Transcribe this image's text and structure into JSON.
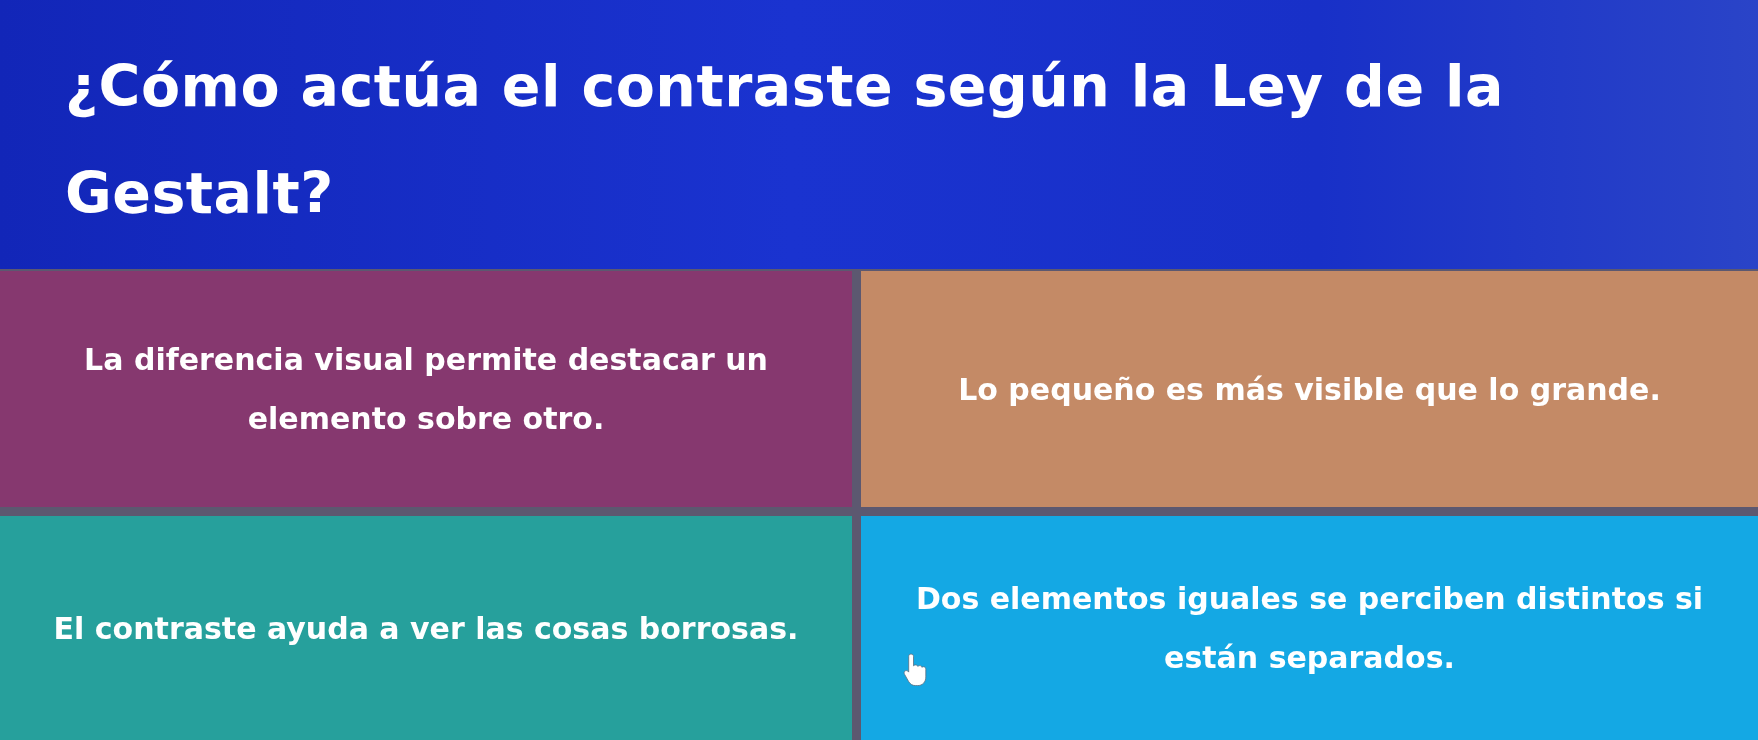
{
  "question": {
    "title": "¿Cómo actúa el contraste según la Ley de la Gestalt?"
  },
  "answers": [
    {
      "text": "La diferencia visual permite destacar un elemento sobre otro.",
      "color": "#86386f"
    },
    {
      "text": "Lo pequeño es más visible que lo grande.",
      "color": "#c48a66"
    },
    {
      "text": "El contraste ayuda a ver las cosas borrosas.",
      "color": "#26a09c"
    },
    {
      "text": "Dos elementos iguales se perciben distintos si están separados.",
      "color": "#14a8e4"
    }
  ]
}
